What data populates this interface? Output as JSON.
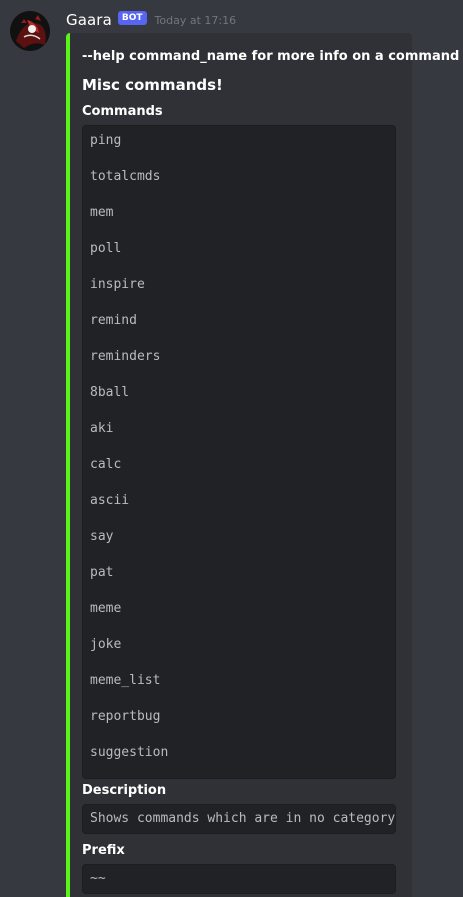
{
  "message": {
    "author": "Gaara",
    "badge": "BOT",
    "timestamp": "Today at 17:16",
    "avatar_icon": "red-black-anime-avatar-icon"
  },
  "embed": {
    "accent_color": "#5af518",
    "description": "--help command_name for more info on a command",
    "title": "Misc commands!",
    "fields": {
      "commands": {
        "name": "Commands",
        "items": [
          "ping",
          "totalcmds",
          "mem",
          "poll",
          "inspire",
          "remind",
          "reminders",
          "8ball",
          "aki",
          "calc",
          "ascii",
          "say",
          "pat",
          "meme",
          "joke",
          "meme_list",
          "reportbug",
          "suggestion"
        ]
      },
      "description": {
        "name": "Description",
        "value": "Shows commands which are in no category"
      },
      "prefix": {
        "name": "Prefix",
        "value": "~~"
      }
    }
  },
  "colors": {
    "background": "#36393f",
    "embed_background": "#2f3136",
    "codeblock_background": "#202225",
    "bot_badge": "#5865f2"
  }
}
